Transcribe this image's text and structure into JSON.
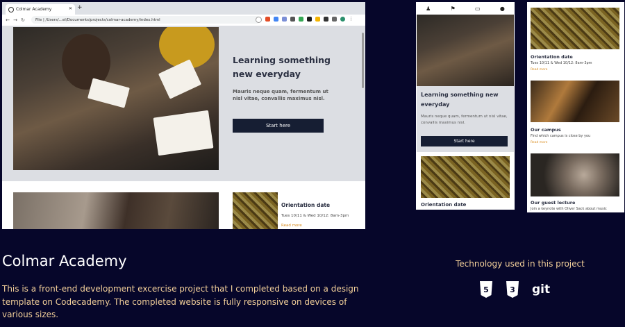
{
  "browser": {
    "tab_title": "Colmar Academy",
    "new_tab": "+",
    "url": "File  |  /Users/...el/Documents/projects/colmar-academy/index.html"
  },
  "desktop": {
    "hero_title": "Learning something new everyday",
    "hero_text": "Mauris neque quam, fermentum ut nisl vitae, convallis maximus nisl.",
    "hero_button": "Start here",
    "event_title": "Orientation date",
    "event_text": "Tues 10/11 & Wed 10/12: 8am-3pm",
    "event_link": "Read more"
  },
  "mobile1": {
    "hero_title": "Learning something new everyday",
    "hero_text": "Mauris neque quam, fermentum ut nisl vitae, convallis maximus nisl.",
    "hero_button": "Start here",
    "caption": "Orientation date"
  },
  "mobile2": {
    "items": [
      {
        "title": "Orientation date",
        "text": "Tues 10/11 & Wed 10/12: 8am-3pm",
        "link": "Read more"
      },
      {
        "title": "Our campus",
        "text": "Find which campus is close by you",
        "link": "Read more"
      },
      {
        "title": "Our guest lecture",
        "text": "Join a keynote with Oliver Sack about music"
      }
    ]
  },
  "project": {
    "title": "Colmar Academy",
    "description": "This is a front-end development excercise project that I completed based on a design template on Codecademy. The completed website is fully responsive on devices of various sizes.",
    "tech_title": "Technology used in this project",
    "tech": [
      {
        "icon": "html5-icon",
        "label": "5"
      },
      {
        "icon": "css3-icon",
        "label": "3"
      },
      {
        "icon": "git-icon",
        "label": "git"
      }
    ]
  },
  "colors": {
    "background": "#06062a",
    "accent_text": "#f3d09a",
    "button": "#161e33",
    "link": "#d88a1a"
  }
}
